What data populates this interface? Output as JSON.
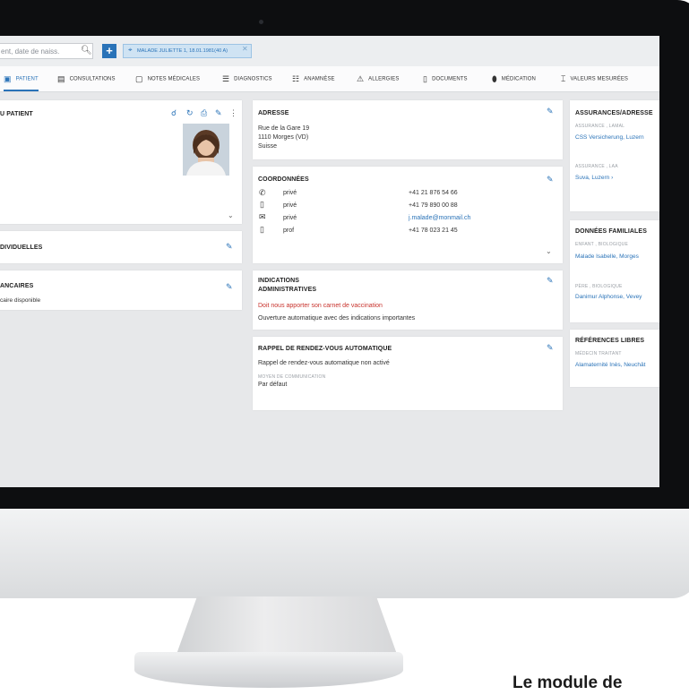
{
  "search": {
    "placeholder": "ent, date de naiss."
  },
  "patient_chip": "MALADE JULIETTE 1, 18.01.1981(40 A)",
  "tabs": [
    {
      "label": "PATIENT"
    },
    {
      "label": "CONSULTATIONS"
    },
    {
      "label": "NOTES MÉDICALES"
    },
    {
      "label": "DIAGNOSTICS"
    },
    {
      "label": "ANAMNÈSE"
    },
    {
      "label": "ALLERGIES"
    },
    {
      "label": "DOCUMENTS"
    },
    {
      "label": "MÉDICATION"
    },
    {
      "label": "VALEURS MESURÉES"
    }
  ],
  "left": {
    "patient_title": "U PATIENT",
    "individuelles_title": "DIVIDUELLES",
    "bancaires_title": "ANCAIRES",
    "bancaires_text": "caire disponible"
  },
  "adresse": {
    "title": "ADRESSE",
    "line1": "Rue de la Gare 19",
    "line2": "1110 Morges (VD)",
    "line3": "Suisse"
  },
  "coordonnees": {
    "title": "COORDONNÉES",
    "rows": [
      {
        "type": "privé",
        "value": "+41 21 876 54 66"
      },
      {
        "type": "privé",
        "value": "+41 79 890 00 88"
      },
      {
        "type": "privé",
        "value": "j.malade@monmail.ch"
      },
      {
        "type": "prof",
        "value": "+41 78 023 21 45"
      }
    ]
  },
  "indications": {
    "title1": "INDICATIONS",
    "title2": "ADMINISTRATIVES",
    "warning": "Doit nous apporter son carnet de vaccination",
    "note": "Ouverture automatique avec des indications importantes"
  },
  "rappel": {
    "title": "RAPPEL DE RENDEZ-VOUS AUTOMATIQUE",
    "status": "Rappel de rendez-vous automatique non activé",
    "label": "MOYEN DE COMMUNICATION",
    "value": "Par défaut"
  },
  "assurances": {
    "title": "ASSURANCES/ADRESSE",
    "lamal_label": "ASSURANCE , LAMAL",
    "lamal_value": "CSS Versicherung, Luzern",
    "laa_label": "ASSURANCE , LAA",
    "laa_value": "Suva, Luzern"
  },
  "familiales": {
    "title": "DONNÉES FAMILIALES",
    "enfant_label": "ENFANT , BIOLOGIQUE",
    "enfant_value": "Malade Isabelle, Morges",
    "pere_label": "PÈRE , BIOLOGIQUE",
    "pere_value": "Danimur Alphonse, Vevey"
  },
  "references": {
    "title": "RÉFÉRENCES LIBRES",
    "label": "MÉDECIN TRAITANT",
    "value": "Alamaternité Inès, Neuchât"
  },
  "caption": "Le module de",
  "colors": {
    "accent": "#2a73b8",
    "warning": "#c8322c"
  }
}
